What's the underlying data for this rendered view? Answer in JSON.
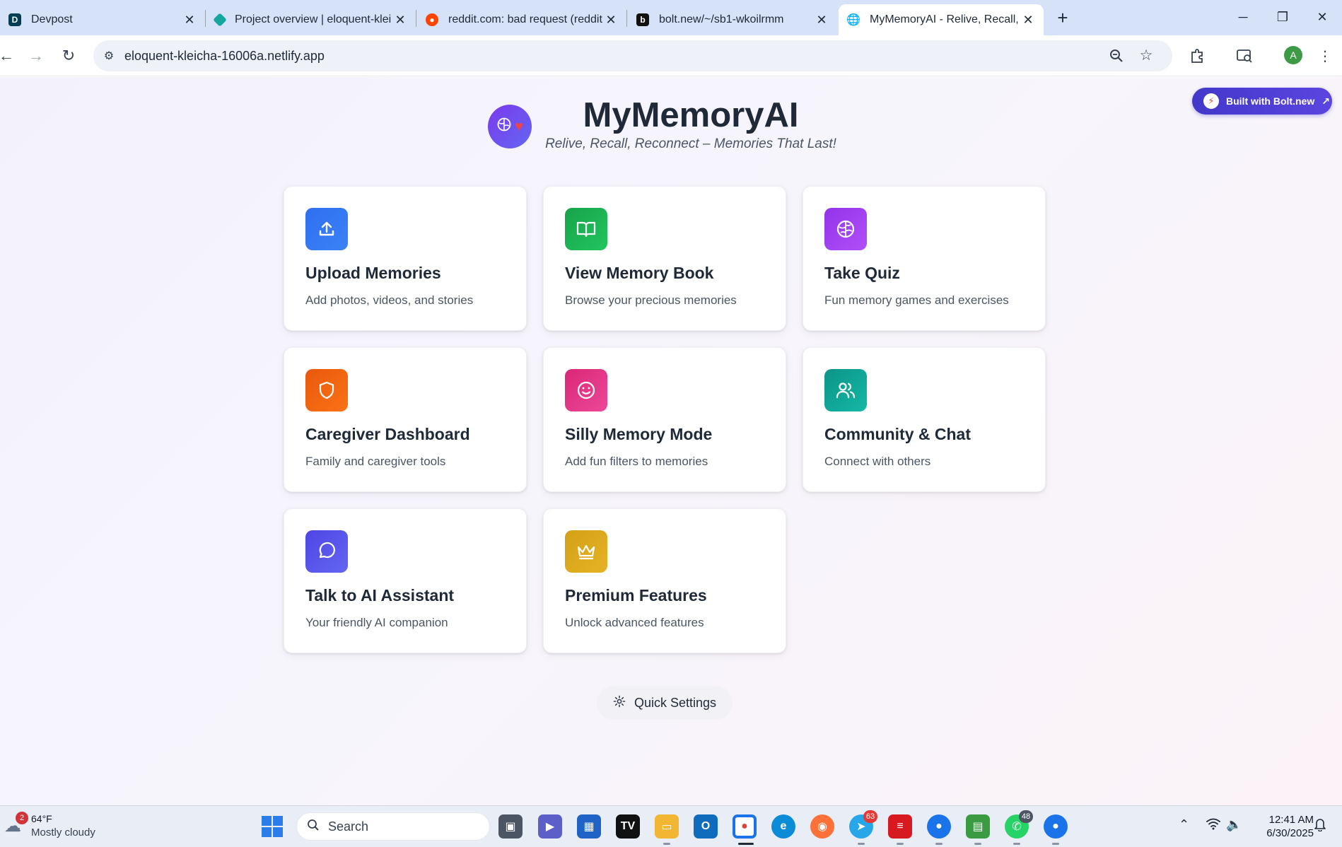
{
  "browser": {
    "tabs": [
      {
        "title": "Devpost",
        "favicon": "devpost-icon",
        "color": "#003e54",
        "active": false
      },
      {
        "title": "Project overview | eloquent-klei",
        "favicon": "netlify-icon",
        "color": "#15a6a0",
        "active": false
      },
      {
        "title": "reddit.com: bad request (reddit",
        "favicon": "reddit-icon",
        "color": "#ff4500",
        "active": false
      },
      {
        "title": "bolt.new/~/sb1-wkoilrmm",
        "favicon": "bolt-icon",
        "color": "#111111",
        "active": false
      },
      {
        "title": "MyMemoryAI - Relive, Recall, Re",
        "favicon": "globe-icon",
        "color": "#5f6368",
        "active": true
      }
    ],
    "url": "eloquent-kleicha-16006a.netlify.app",
    "profile_initial": "A"
  },
  "page": {
    "badge": "Built with Bolt.new",
    "app_title": "MyMemoryAI",
    "subtitle": "Relive, Recall, Reconnect – Memories That Last!",
    "cards": [
      {
        "title": "Upload Memories",
        "description": "Add photos, videos, and stories",
        "icon": "upload-icon",
        "gradient": [
          "#2f6ff0",
          "#3b82f6"
        ]
      },
      {
        "title": "View Memory Book",
        "description": "Browse your precious memories",
        "icon": "book-icon",
        "gradient": [
          "#17a34a",
          "#22c55e"
        ]
      },
      {
        "title": "Take Quiz",
        "description": "Fun memory games and exercises",
        "icon": "brain-icon",
        "gradient": [
          "#9333ea",
          "#b14ff7"
        ]
      },
      {
        "title": "Caregiver Dashboard",
        "description": "Family and caregiver tools",
        "icon": "shield-icon",
        "gradient": [
          "#ea580c",
          "#f97316"
        ]
      },
      {
        "title": "Silly Memory Mode",
        "description": "Add fun filters to memories",
        "icon": "smile-icon",
        "gradient": [
          "#db2777",
          "#ec4899"
        ]
      },
      {
        "title": "Community & Chat",
        "description": "Connect with others",
        "icon": "users-icon",
        "gradient": [
          "#0d9488",
          "#14b8a6"
        ]
      },
      {
        "title": "Talk to AI Assistant",
        "description": "Your friendly AI companion",
        "icon": "chat-bubble-icon",
        "gradient": [
          "#4f46e5",
          "#6366f1"
        ]
      },
      {
        "title": "Premium Features",
        "description": "Unlock advanced features",
        "icon": "crown-icon",
        "gradient": [
          "#d4a017",
          "#e6b325"
        ]
      }
    ],
    "settings_button": "Quick Settings"
  },
  "taskbar": {
    "weather_temp": "64°F",
    "weather_condition": "Mostly cloudy",
    "weather_badge": "2",
    "search_placeholder": "Search",
    "badges": {
      "telegram": "63",
      "whatsapp": "48"
    },
    "time": "12:41 AM",
    "date": "6/30/2025"
  }
}
